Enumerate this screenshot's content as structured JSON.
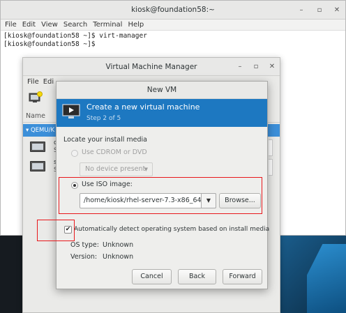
{
  "terminal": {
    "title": "kiosk@foundation58:~",
    "controls": {
      "minimize": "–",
      "maximize": "▫",
      "close": "✕"
    },
    "menu": [
      "File",
      "Edit",
      "View",
      "Search",
      "Terminal",
      "Help"
    ],
    "lines": [
      "[kiosk@foundation58 ~]$ virt-manager",
      "[kiosk@foundation58 ~]$"
    ]
  },
  "vmm": {
    "title": "Virtual Machine Manager",
    "controls": {
      "minimize": "–",
      "maximize": "▫",
      "close": "✕"
    },
    "menu": [
      "File",
      "Edi"
    ],
    "column_header": "Name",
    "group": "▾ QEMU/K",
    "rows": [
      {
        "name": "de",
        "state": "St"
      },
      {
        "name": "se",
        "state": "St"
      }
    ]
  },
  "new_vm": {
    "title": "New VM",
    "banner_title": "Create a new virtual machine",
    "banner_step": "Step 2 of 5",
    "locate_label": "Locate your install media",
    "cdrom_label": "Use CDROM or DVD",
    "cdrom_combo": "No device present",
    "iso_label": "Use ISO image:",
    "iso_path": "/home/kiosk/rhel-server-7.3-x86_64",
    "browse_label": "Browse...",
    "autodetect_label": "Automatically detect operating system based on install media",
    "autodetect_checked": "✔",
    "os_type_label": "OS type:",
    "os_type_value": "Unknown",
    "version_label": "Version:",
    "version_value": "Unknown",
    "cancel_label": "Cancel",
    "back_label": "Back",
    "forward_label": "Forward"
  },
  "colors": {
    "banner": "#1d78c1",
    "selection": "#3c8fd9",
    "highlight_box": "#e8171b"
  }
}
